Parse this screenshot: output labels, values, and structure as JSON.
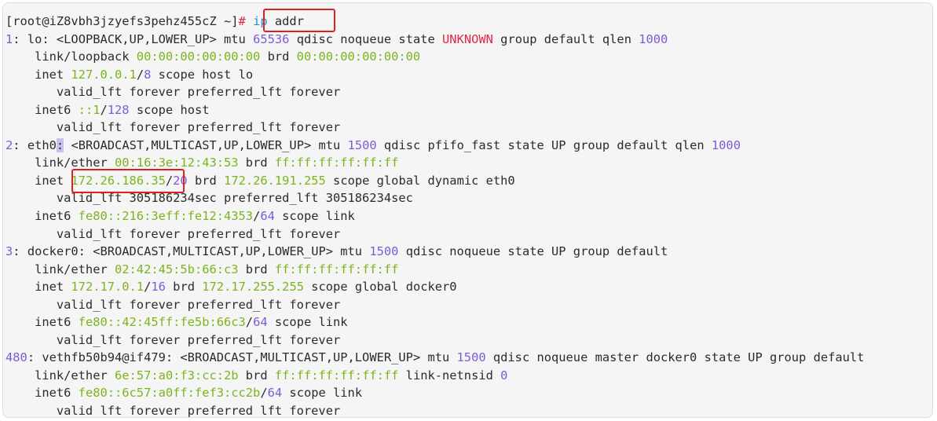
{
  "colors": {
    "default": "#2b2b2b",
    "num": "#7e5bd6",
    "addr": "#7ab51d",
    "state_unknown": "#e0284a",
    "flags": "#2b2b2b",
    "prompt_hash": "#e0284a",
    "cmd": "#1a8fd1",
    "highlight_border": "#e02020",
    "terminal_bg": "#f5f5f5"
  },
  "terminal": {
    "lines": [
      [
        {
          "t": "[root@iZ8vbh3jzyefs3pehz455cZ ~]",
          "c": "default"
        },
        {
          "t": "#",
          "c": "prompt_hash"
        },
        {
          "t": " ",
          "c": "default"
        },
        {
          "t": "ip",
          "c": "cmd"
        },
        {
          "t": " addr",
          "c": "default"
        }
      ],
      [
        {
          "t": "1",
          "c": "num"
        },
        {
          "t": ": lo: ",
          "c": "default"
        },
        {
          "t": "<LOOPBACK,UP,LOWER_UP>",
          "c": "flags"
        },
        {
          "t": " mtu ",
          "c": "default"
        },
        {
          "t": "65536",
          "c": "num"
        },
        {
          "t": " qdisc noqueue state ",
          "c": "default"
        },
        {
          "t": "UNKNOWN",
          "c": "state_unknown"
        },
        {
          "t": " group default qlen ",
          "c": "default"
        },
        {
          "t": "1000",
          "c": "num"
        }
      ],
      [
        {
          "t": "    link/loopback ",
          "c": "default"
        },
        {
          "t": "00:00:00:00:00:00",
          "c": "addr"
        },
        {
          "t": " brd ",
          "c": "default"
        },
        {
          "t": "00:00:00:00:00:00",
          "c": "addr"
        }
      ],
      [
        {
          "t": "    inet ",
          "c": "default"
        },
        {
          "t": "127.0.0.1",
          "c": "addr"
        },
        {
          "t": "/",
          "c": "default"
        },
        {
          "t": "8",
          "c": "num"
        },
        {
          "t": " scope host lo",
          "c": "default"
        }
      ],
      [
        {
          "t": "       valid_lft forever preferred_lft forever",
          "c": "default"
        }
      ],
      [
        {
          "t": "    inet6 ",
          "c": "default"
        },
        {
          "t": "::1",
          "c": "addr"
        },
        {
          "t": "/",
          "c": "default"
        },
        {
          "t": "128",
          "c": "num"
        },
        {
          "t": " scope host",
          "c": "default"
        }
      ],
      [
        {
          "t": "       valid_lft forever preferred_lft forever",
          "c": "default"
        }
      ],
      [
        {
          "t": "2",
          "c": "num"
        },
        {
          "t": ": eth0",
          "c": "default"
        },
        {
          "t": ":",
          "c": "cursor"
        },
        {
          "t": " ",
          "c": "default"
        },
        {
          "t": "<BROADCAST,MULTICAST,UP,LOWER_UP>",
          "c": "flags"
        },
        {
          "t": " mtu ",
          "c": "default"
        },
        {
          "t": "1500",
          "c": "num"
        },
        {
          "t": " qdisc pfifo_fast state UP group default qlen ",
          "c": "default"
        },
        {
          "t": "1000",
          "c": "num"
        }
      ],
      [
        {
          "t": "    link/ether ",
          "c": "default"
        },
        {
          "t": "00:16:3e:12:43:53",
          "c": "addr"
        },
        {
          "t": " brd ",
          "c": "default"
        },
        {
          "t": "ff:ff:ff:ff:ff:ff",
          "c": "addr"
        }
      ],
      [
        {
          "t": "    inet ",
          "c": "default"
        },
        {
          "t": "172.26.186.35",
          "c": "addr"
        },
        {
          "t": "/",
          "c": "default"
        },
        {
          "t": "20",
          "c": "num"
        },
        {
          "t": " brd ",
          "c": "default"
        },
        {
          "t": "172.26.191.255",
          "c": "addr"
        },
        {
          "t": " scope global dynamic eth0",
          "c": "default"
        }
      ],
      [
        {
          "t": "       valid_lft 305186234sec preferred_lft 305186234sec",
          "c": "default"
        }
      ],
      [
        {
          "t": "    inet6 ",
          "c": "default"
        },
        {
          "t": "fe80::216:3eff:fe12:4353",
          "c": "addr"
        },
        {
          "t": "/",
          "c": "default"
        },
        {
          "t": "64",
          "c": "num"
        },
        {
          "t": " scope link",
          "c": "default"
        }
      ],
      [
        {
          "t": "       valid_lft forever preferred_lft forever",
          "c": "default"
        }
      ],
      [
        {
          "t": "3",
          "c": "num"
        },
        {
          "t": ": docker0: ",
          "c": "default"
        },
        {
          "t": "<BROADCAST,MULTICAST,UP,LOWER_UP>",
          "c": "flags"
        },
        {
          "t": " mtu ",
          "c": "default"
        },
        {
          "t": "1500",
          "c": "num"
        },
        {
          "t": " qdisc noqueue state UP group default",
          "c": "default"
        }
      ],
      [
        {
          "t": "    link/ether ",
          "c": "default"
        },
        {
          "t": "02:42:45:5b:66:c3",
          "c": "addr"
        },
        {
          "t": " brd ",
          "c": "default"
        },
        {
          "t": "ff:ff:ff:ff:ff:ff",
          "c": "addr"
        }
      ],
      [
        {
          "t": "    inet ",
          "c": "default"
        },
        {
          "t": "172.17.0.1",
          "c": "addr"
        },
        {
          "t": "/",
          "c": "default"
        },
        {
          "t": "16",
          "c": "num"
        },
        {
          "t": " brd ",
          "c": "default"
        },
        {
          "t": "172.17.255.255",
          "c": "addr"
        },
        {
          "t": " scope global docker0",
          "c": "default"
        }
      ],
      [
        {
          "t": "       valid_lft forever preferred_lft forever",
          "c": "default"
        }
      ],
      [
        {
          "t": "    inet6 ",
          "c": "default"
        },
        {
          "t": "fe80::42:45ff:fe5b:66c3",
          "c": "addr"
        },
        {
          "t": "/",
          "c": "default"
        },
        {
          "t": "64",
          "c": "num"
        },
        {
          "t": " scope link",
          "c": "default"
        }
      ],
      [
        {
          "t": "       valid_lft forever preferred_lft forever",
          "c": "default"
        }
      ],
      [
        {
          "t": "480",
          "c": "num"
        },
        {
          "t": ": vethfb50b94@if479: ",
          "c": "default"
        },
        {
          "t": "<BROADCAST,MULTICAST,UP,LOWER_UP>",
          "c": "flags"
        },
        {
          "t": " mtu ",
          "c": "default"
        },
        {
          "t": "1500",
          "c": "num"
        },
        {
          "t": " qdisc noqueue master docker0 state UP group default",
          "c": "default"
        }
      ],
      [
        {
          "t": "    link/ether ",
          "c": "default"
        },
        {
          "t": "6e:57:a0:f3:cc:2b",
          "c": "addr"
        },
        {
          "t": " brd ",
          "c": "default"
        },
        {
          "t": "ff:ff:ff:ff:ff:ff",
          "c": "addr"
        },
        {
          "t": " link-netnsid ",
          "c": "default"
        },
        {
          "t": "0",
          "c": "num"
        }
      ],
      [
        {
          "t": "    inet6 ",
          "c": "default"
        },
        {
          "t": "fe80::6c57:a0ff:fef3:cc2b",
          "c": "addr"
        },
        {
          "t": "/",
          "c": "default"
        },
        {
          "t": "64",
          "c": "num"
        },
        {
          "t": " scope link",
          "c": "default"
        }
      ],
      [
        {
          "t": "       valid_lft forever preferred_lft forever",
          "c": "default"
        }
      ]
    ]
  }
}
